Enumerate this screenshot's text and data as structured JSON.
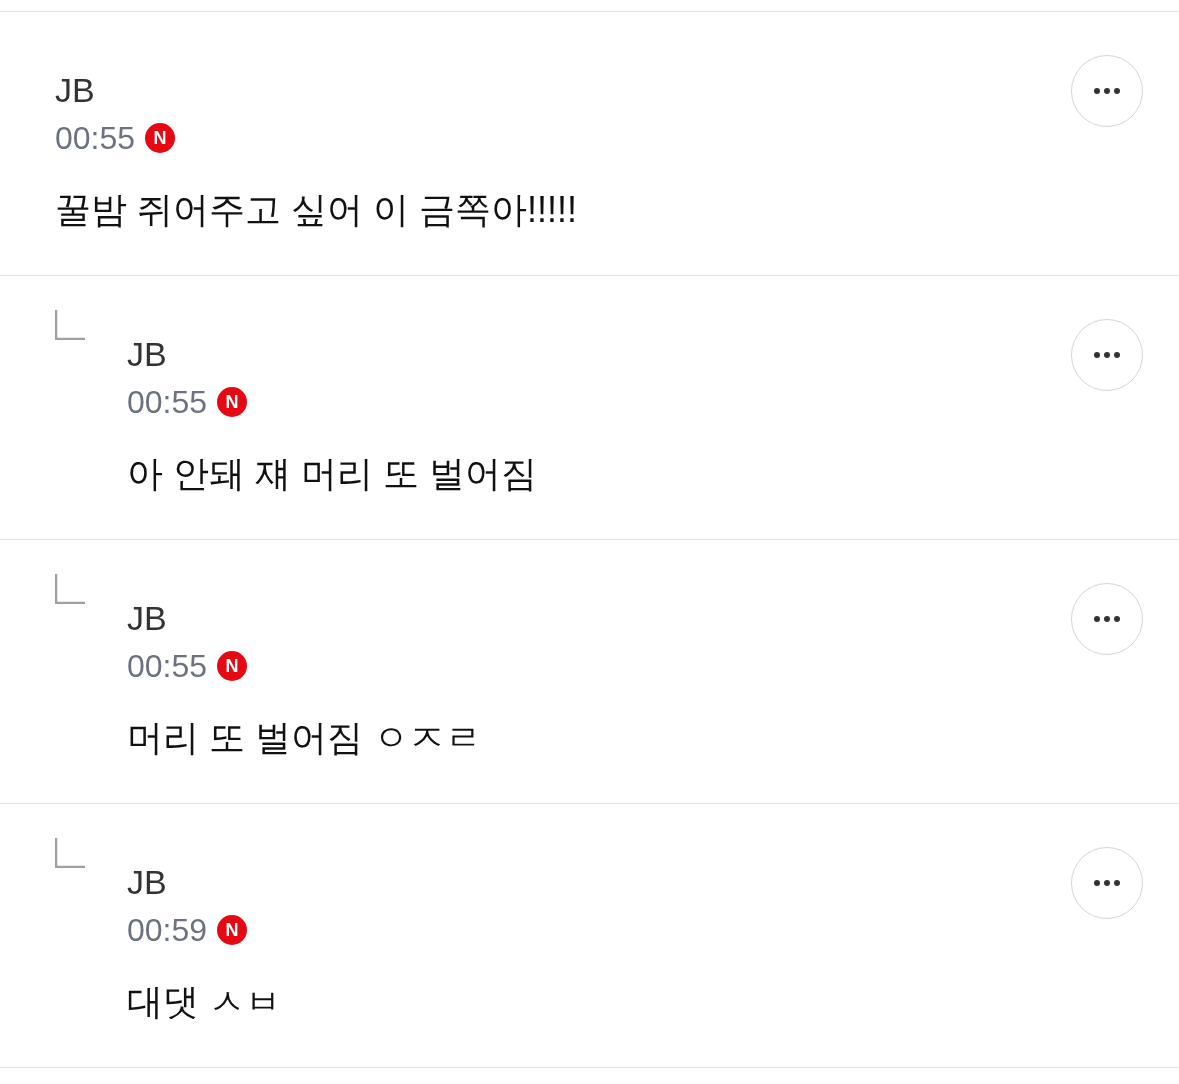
{
  "comments": [
    {
      "kind": "comment",
      "author": "JB",
      "time": "00:55",
      "badge": "N",
      "text": "꿀밤 쥐어주고 싶어 이 금쪽아!!!!!"
    },
    {
      "kind": "reply",
      "author": "JB",
      "time": "00:55",
      "badge": "N",
      "text": "아 안돼 쟤 머리 또 벌어짐"
    },
    {
      "kind": "reply",
      "author": "JB",
      "time": "00:55",
      "badge": "N",
      "text": "머리 또 벌어짐 ㅇㅈㄹ"
    },
    {
      "kind": "reply",
      "author": "JB",
      "time": "00:59",
      "badge": "N",
      "text": "대댓 ㅅㅂ"
    }
  ]
}
